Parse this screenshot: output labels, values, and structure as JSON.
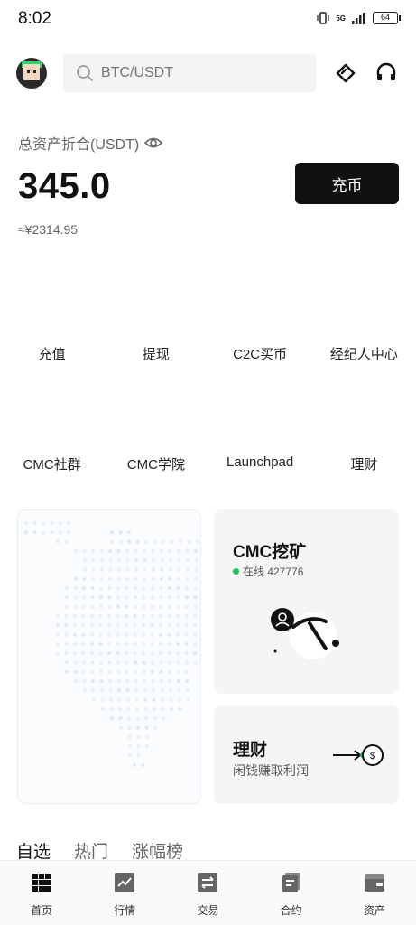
{
  "status_bar": {
    "time": "8:02",
    "network": "5G",
    "battery": "64"
  },
  "header": {
    "search_placeholder": "BTC/USDT",
    "icons": [
      "avatar",
      "diamond-icon",
      "headset-icon"
    ]
  },
  "assets": {
    "label": "总资产折合(USDT)",
    "amount": "345.0",
    "cny": "≈¥2314.95",
    "deposit_label": "充币"
  },
  "quick_actions_row1": [
    {
      "label": "充值"
    },
    {
      "label": "提现"
    },
    {
      "label": "C2C买币"
    },
    {
      "label": "经纪人中心"
    }
  ],
  "quick_actions_row2": [
    {
      "label": "CMC社群"
    },
    {
      "label": "CMC学院"
    },
    {
      "label": "Launchpad"
    },
    {
      "label": "理财"
    }
  ],
  "mining_card": {
    "title": "CMC挖矿",
    "online_label": "在线 427776"
  },
  "finance_card": {
    "title": "理财",
    "subtitle": "闲钱赚取利润"
  },
  "market_tabs": [
    {
      "label": "自选",
      "active": true
    },
    {
      "label": "热门",
      "active": false
    },
    {
      "label": "涨幅榜",
      "active": false
    }
  ],
  "bottom_nav": [
    {
      "label": "首页",
      "icon": "home-grid-icon"
    },
    {
      "label": "行情",
      "icon": "chart-icon"
    },
    {
      "label": "交易",
      "icon": "exchange-icon"
    },
    {
      "label": "合约",
      "icon": "contract-icon"
    },
    {
      "label": "资产",
      "icon": "wallet-icon"
    }
  ],
  "colors": {
    "accent": "#111111",
    "online": "#17c25b",
    "card_bg": "#f5f5f5"
  }
}
